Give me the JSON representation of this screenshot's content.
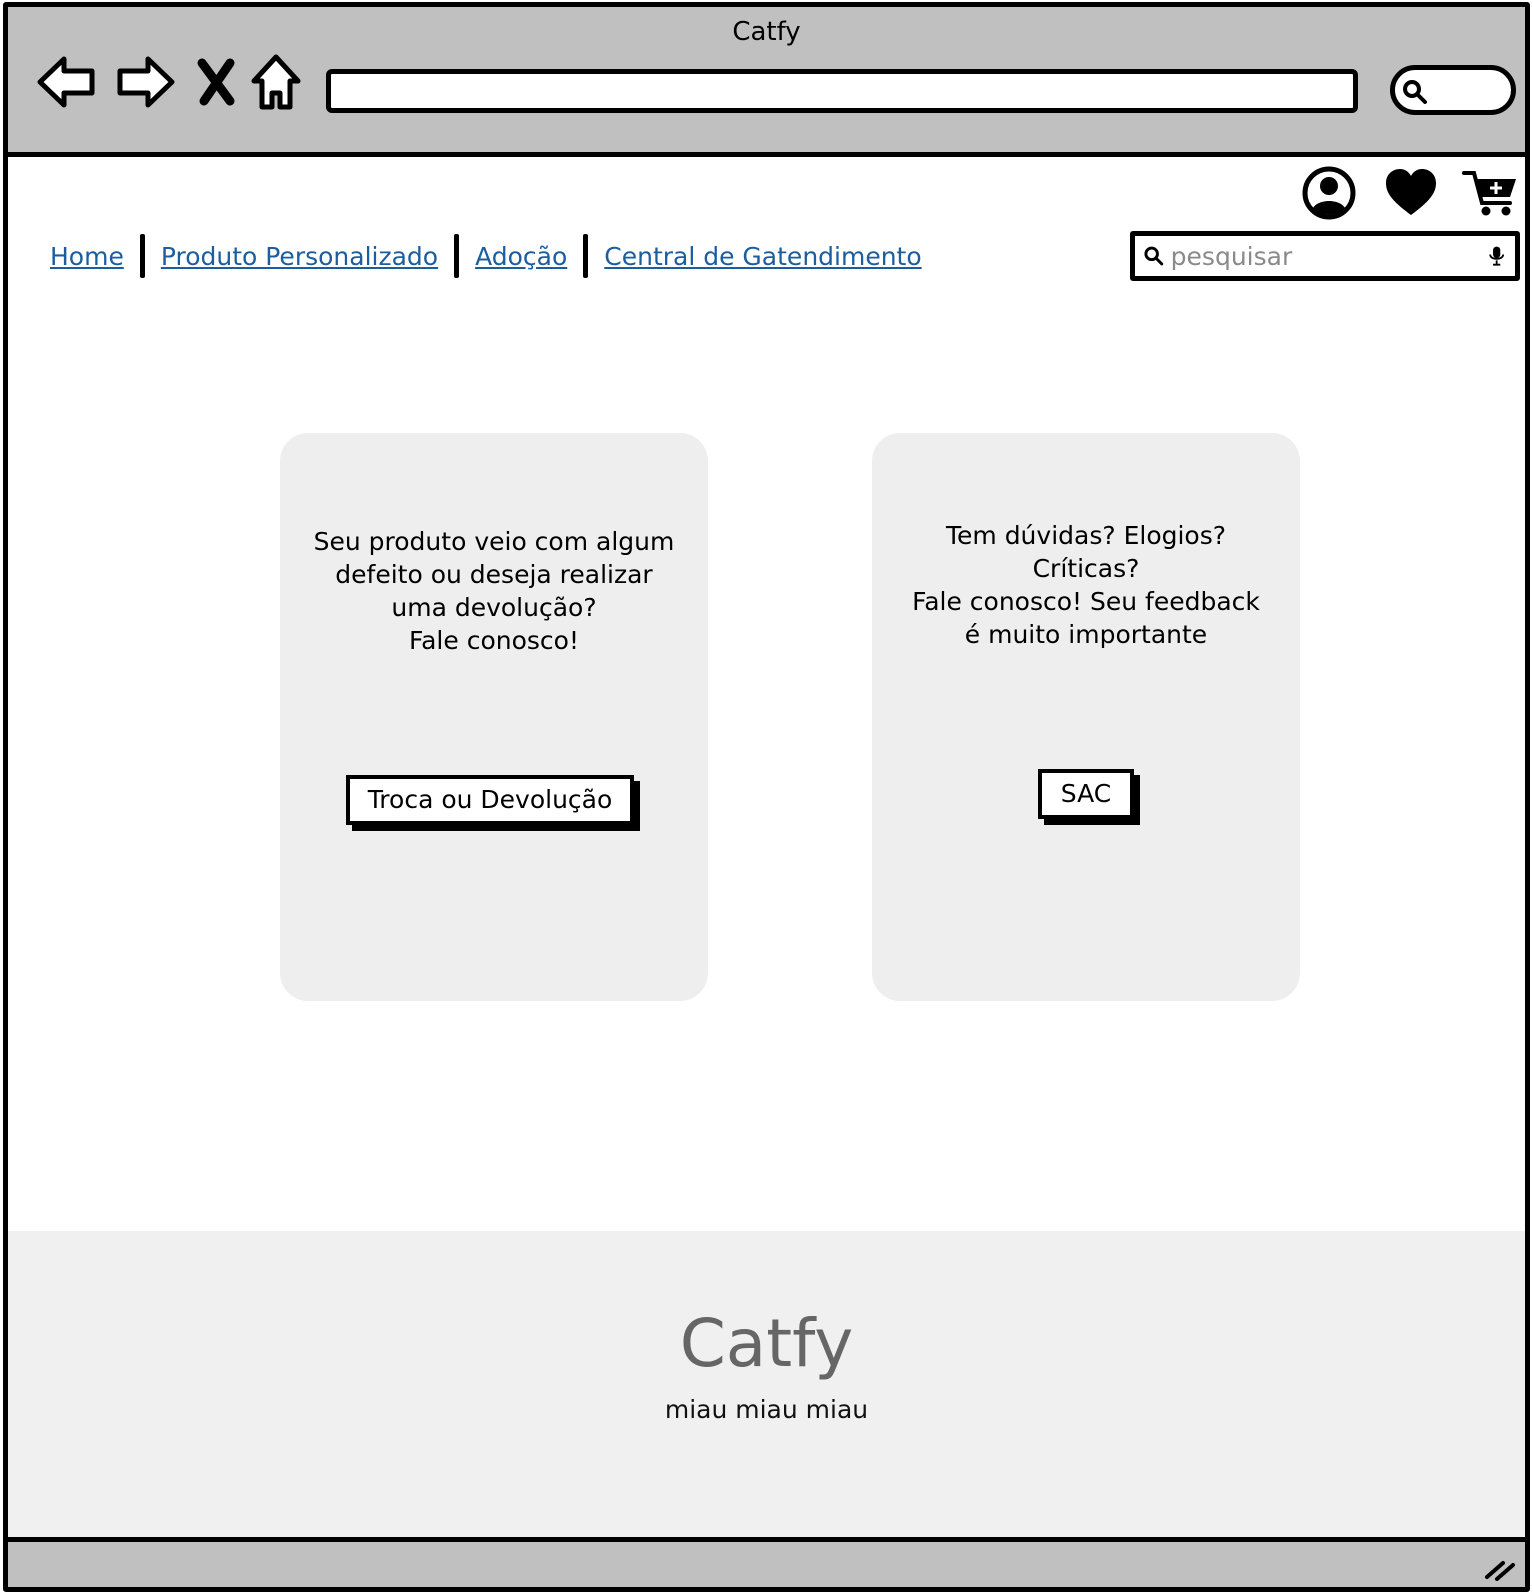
{
  "window": {
    "title": "Catfy"
  },
  "browser": {
    "icons": {
      "back": "arrow-left-icon",
      "forward": "arrow-right-icon",
      "stop": "close-icon",
      "home": "home-icon",
      "search": "search-icon"
    },
    "address_value": ""
  },
  "header": {
    "icons": [
      "user-circle-icon",
      "heart-icon",
      "add-to-cart-icon"
    ],
    "nav": [
      {
        "label": "Home"
      },
      {
        "label": "Produto Personalizado"
      },
      {
        "label": "Adoção"
      },
      {
        "label": "Central de Gatendimento"
      }
    ],
    "search": {
      "placeholder": "pesquisar",
      "value": ""
    }
  },
  "cards": [
    {
      "text": "Seu produto veio com algum\ndefeito ou deseja realizar\numa devolução?\nFale conosco!",
      "button_label": "Troca ou Devolução"
    },
    {
      "text": "Tem dúvidas? Elogios?\nCríticas?\nFale conosco! Seu feedback\né muito importante",
      "button_label": "SAC"
    }
  ],
  "footer": {
    "brand": "Catfy",
    "tagline": "miau miau miau"
  },
  "colors": {
    "link": "#1b5ea0",
    "chrome": "#c0c0c0",
    "card_bg": "#eeeeee",
    "footer_bg": "#f0f0f0",
    "footer_brand": "#666666"
  }
}
